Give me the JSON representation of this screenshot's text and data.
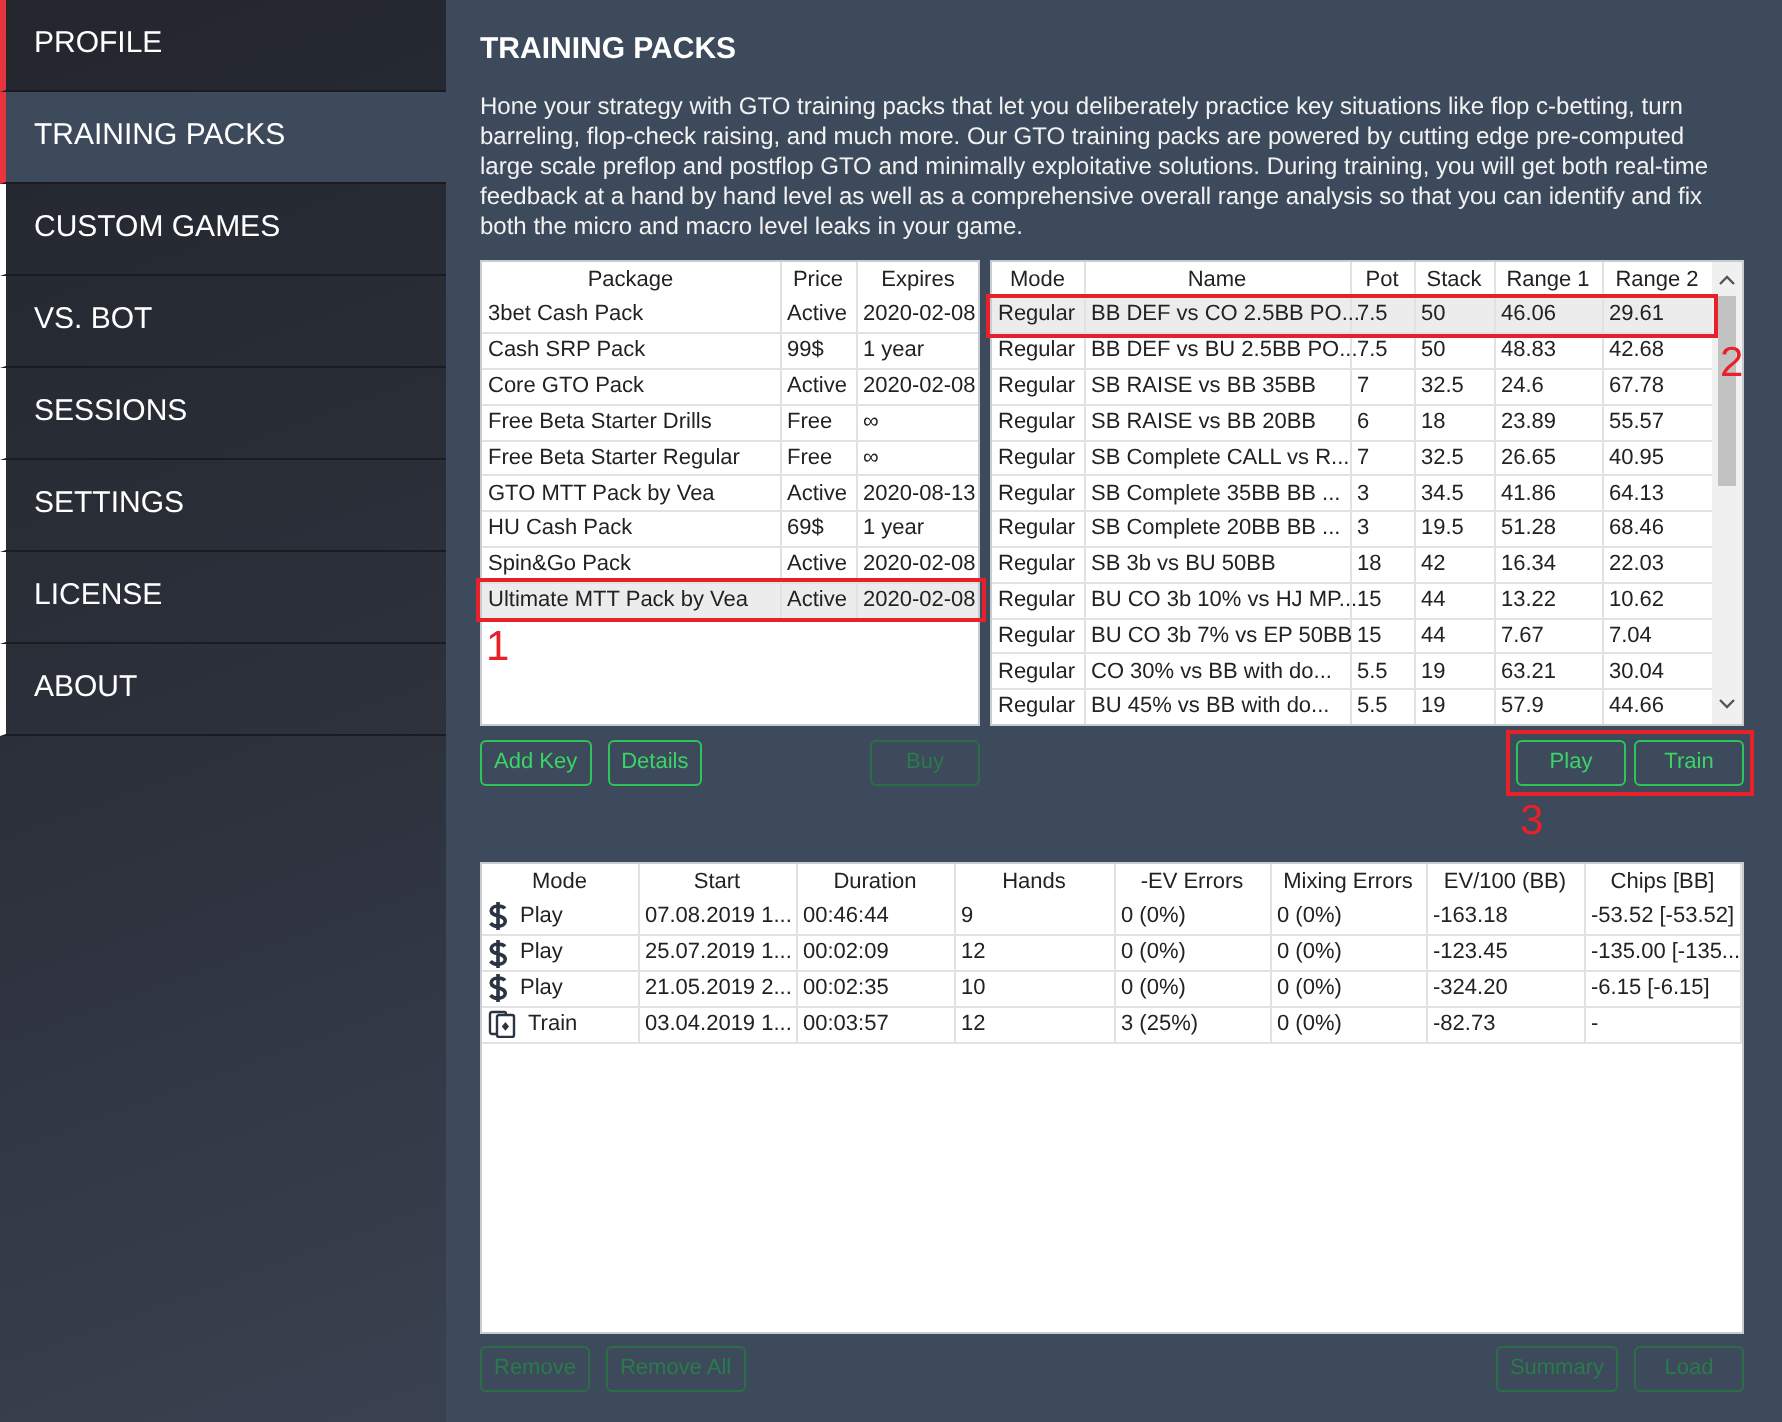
{
  "sidebar": {
    "items": [
      {
        "label": "PROFILE",
        "selected": false,
        "color": "#e8343f"
      },
      {
        "label": "TRAINING PACKS",
        "selected": true,
        "color": "#e8343f"
      },
      {
        "label": "CUSTOM GAMES",
        "selected": false,
        "color": "#ffffff"
      },
      {
        "label": "VS. BOT",
        "selected": false,
        "color": "#ffffff"
      },
      {
        "label": "SESSIONS",
        "selected": false,
        "color": "#ffffff"
      },
      {
        "label": "SETTINGS",
        "selected": false,
        "color": "#ffffff"
      },
      {
        "label": "LICENSE",
        "selected": false,
        "color": "#ffffff"
      },
      {
        "label": "ABOUT",
        "selected": false,
        "color": "#ffffff"
      }
    ]
  },
  "page": {
    "title": "TRAINING PACKS",
    "description": "Hone your strategy with GTO training packs that let you deliberately practice key situations like flop c-betting, turn barreling, flop-check raising, and much more.  Our GTO training packs are powered by cutting edge pre-computed large scale preflop and postflop GTO and minimally exploitative solutions. During training, you will get both real-time feedback at a hand by hand level as well as a comprehensive overall range analysis so that you can identify and fix both the micro and macro level leaks in your game."
  },
  "packages": {
    "columns": [
      "Package",
      "Price",
      "Expires"
    ],
    "callout": "1",
    "rows": [
      {
        "cells": [
          "3bet Cash Pack",
          "Active",
          "2020-02-08"
        ],
        "selected": false
      },
      {
        "cells": [
          "Cash SRP Pack",
          "99$",
          "1 year"
        ],
        "selected": false
      },
      {
        "cells": [
          "Core GTO Pack",
          "Active",
          "2020-02-08"
        ],
        "selected": false
      },
      {
        "cells": [
          "Free Beta Starter Drills",
          "Free",
          "∞"
        ],
        "selected": false
      },
      {
        "cells": [
          "Free Beta Starter Regular",
          "Free",
          "∞"
        ],
        "selected": false
      },
      {
        "cells": [
          "GTO MTT Pack by Vea",
          "Active",
          "2020-08-13"
        ],
        "selected": false
      },
      {
        "cells": [
          "HU Cash Pack",
          "69$",
          "1 year"
        ],
        "selected": false
      },
      {
        "cells": [
          "Spin&Go Pack",
          "Active",
          "2020-02-08"
        ],
        "selected": false
      },
      {
        "cells": [
          "Ultimate MTT Pack by Vea",
          "Active",
          "2020-02-08"
        ],
        "selected": true
      }
    ]
  },
  "package_actions": [
    {
      "label": "Add Key",
      "disabled": false
    },
    {
      "label": "Details",
      "disabled": false
    }
  ],
  "buy_button": {
    "label": "Buy",
    "disabled": true
  },
  "scenarios": {
    "columns": [
      "Mode",
      "Name",
      "Pot",
      "Stack",
      "Range 1",
      "Range 2"
    ],
    "callout": "2",
    "rows": [
      {
        "cells": [
          "Regular",
          "BB DEF vs CO 2.5BB PO...",
          "7.5",
          "50",
          "46.06",
          "29.61"
        ],
        "selected": true
      },
      {
        "cells": [
          "Regular",
          "BB DEF vs BU 2.5BB PO...",
          "7.5",
          "50",
          "48.83",
          "42.68"
        ],
        "selected": false
      },
      {
        "cells": [
          "Regular",
          "SB RAISE vs BB 35BB",
          "7",
          "32.5",
          "24.6",
          "67.78"
        ],
        "selected": false
      },
      {
        "cells": [
          "Regular",
          "SB RAISE vs BB 20BB",
          "6",
          "18",
          "23.89",
          "55.57"
        ],
        "selected": false
      },
      {
        "cells": [
          "Regular",
          "SB Complete CALL vs R...",
          "7",
          "32.5",
          "26.65",
          "40.95"
        ],
        "selected": false
      },
      {
        "cells": [
          "Regular",
          "SB Complete 35BB BB ...",
          "3",
          "34.5",
          "41.86",
          "64.13"
        ],
        "selected": false
      },
      {
        "cells": [
          "Regular",
          "SB Complete 20BB BB ...",
          "3",
          "19.5",
          "51.28",
          "68.46"
        ],
        "selected": false
      },
      {
        "cells": [
          "Regular",
          "SB 3b vs BU 50BB",
          "18",
          "42",
          "16.34",
          "22.03"
        ],
        "selected": false
      },
      {
        "cells": [
          "Regular",
          "BU CO 3b 10% vs HJ MP...",
          "15",
          "44",
          "13.22",
          "10.62"
        ],
        "selected": false
      },
      {
        "cells": [
          "Regular",
          "BU CO 3b 7% vs EP 50BB",
          "15",
          "44",
          "7.67",
          "7.04"
        ],
        "selected": false
      },
      {
        "cells": [
          "Regular",
          "CO 30% vs BB with do...",
          "5.5",
          "19",
          "63.21",
          "30.04"
        ],
        "selected": false
      },
      {
        "cells": [
          "Regular",
          "BU 45% vs BB with do...",
          "5.5",
          "19",
          "57.9",
          "44.66"
        ],
        "selected": false
      }
    ]
  },
  "scenario_actions": {
    "callout": "3",
    "buttons": [
      {
        "label": "Play",
        "disabled": false
      },
      {
        "label": "Train",
        "disabled": false
      }
    ]
  },
  "sessions": {
    "columns": [
      "Mode",
      "Start",
      "Duration",
      "Hands",
      "-EV Errors",
      "Mixing Errors",
      "EV/100 (BB)",
      "Chips [BB]"
    ],
    "rows": [
      {
        "kind": "play",
        "cells": [
          "Play",
          "07.08.2019 1...",
          "00:46:44",
          "9",
          "0 (0%)",
          "0 (0%)",
          "-163.18",
          "-53.52 [-53.52]"
        ]
      },
      {
        "kind": "play",
        "cells": [
          "Play",
          "25.07.2019 1...",
          "00:02:09",
          "12",
          "0 (0%)",
          "0 (0%)",
          "-123.45",
          "-135.00 [-135..."
        ]
      },
      {
        "kind": "play",
        "cells": [
          "Play",
          "21.05.2019 2...",
          "00:02:35",
          "10",
          "0 (0%)",
          "0 (0%)",
          "-324.20",
          "-6.15 [-6.15]"
        ]
      },
      {
        "kind": "train",
        "cells": [
          "Train",
          "03.04.2019 1...",
          "00:03:57",
          "12",
          "3 (25%)",
          "0 (0%)",
          "-82.73",
          "-"
        ]
      }
    ]
  },
  "session_actions_left": [
    {
      "label": "Remove",
      "disabled": true
    },
    {
      "label": "Remove All",
      "disabled": true
    }
  ],
  "session_actions_right": [
    {
      "label": "Summary",
      "disabled": true
    },
    {
      "label": "Load",
      "disabled": true
    }
  ]
}
